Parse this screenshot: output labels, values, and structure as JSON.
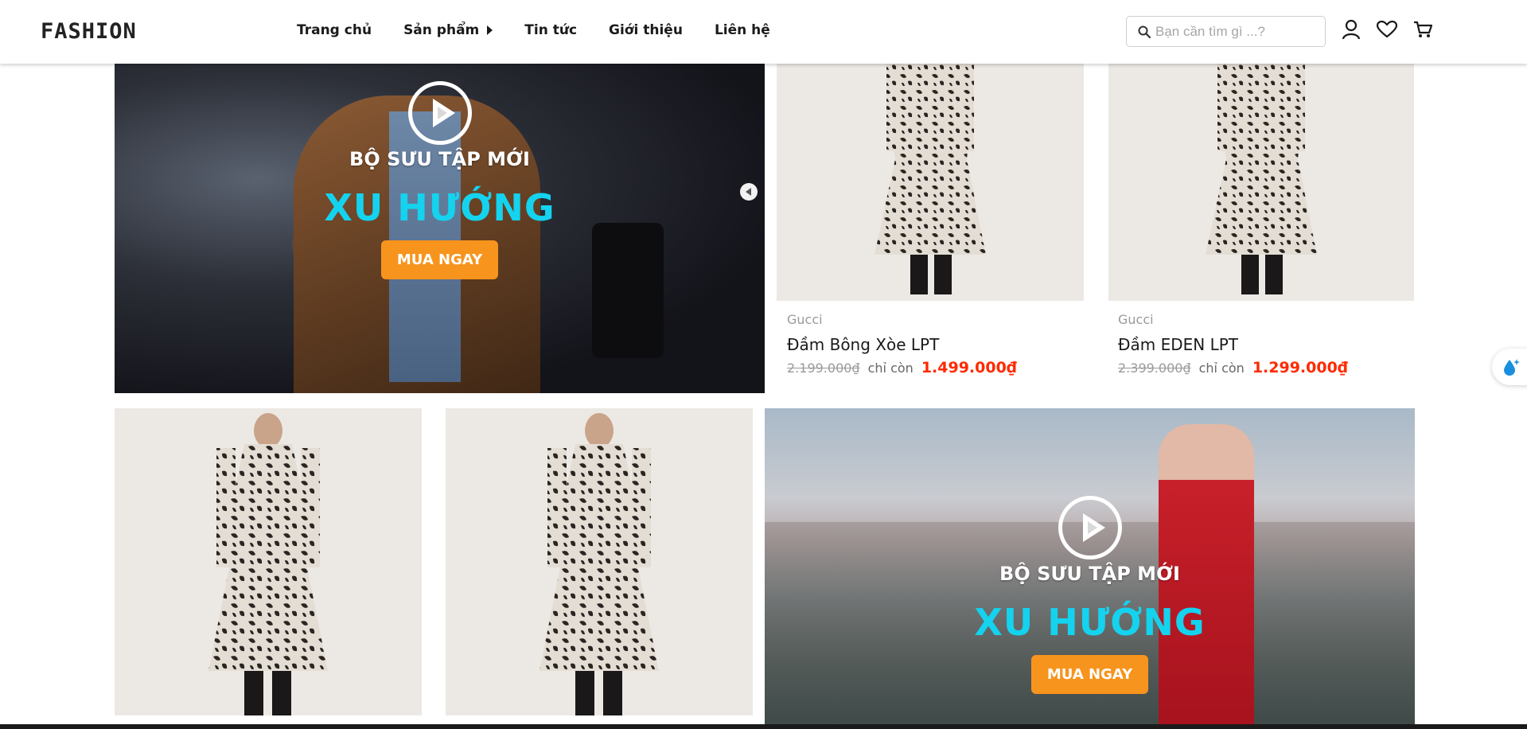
{
  "header": {
    "logo": "FASHION",
    "nav": [
      {
        "label": "Trang chủ"
      },
      {
        "label": "Sản phẩm",
        "has_caret": true
      },
      {
        "label": "Tin tức"
      },
      {
        "label": "Giới thiệu"
      },
      {
        "label": "Liên hệ"
      }
    ],
    "search_placeholder": "Bạn cần tìm gì ...?",
    "icons": [
      "user-icon",
      "heart-icon",
      "cart-icon"
    ]
  },
  "banners": [
    {
      "collection": "BỘ SƯU TẬP MỚI",
      "trend": "XU HƯỚNG",
      "button": "MUA NGAY"
    },
    {
      "collection": "BỘ SƯU TẬP MỚI",
      "trend": "XU HƯỚNG",
      "button": "MUA NGAY"
    }
  ],
  "products": [
    {
      "brand": "Gucci",
      "name": "Đầm Bông Xòe LPT",
      "old_price": "2.199.000₫",
      "only_label": "chỉ còn",
      "new_price": "1.499.000₫"
    },
    {
      "brand": "Gucci",
      "name": "Đầm EDEN LPT",
      "old_price": "2.399.000₫",
      "only_label": "chỉ còn",
      "new_price": "1.299.000₫"
    }
  ],
  "colors": {
    "accent_button": "#f7941d",
    "trend_text": "#14d3ef",
    "sale_price": "#ff2a00"
  }
}
